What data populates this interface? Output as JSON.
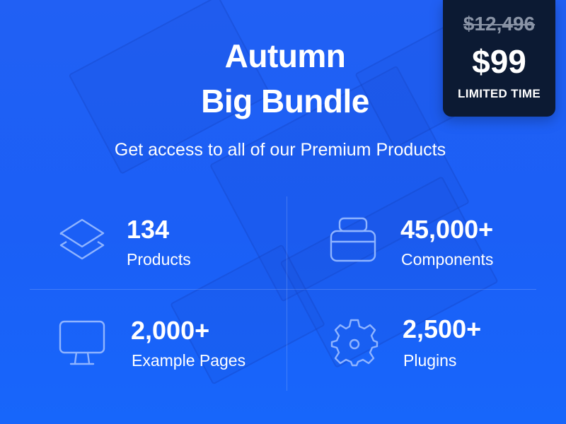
{
  "hero": {
    "title_line1": "Autumn",
    "title_line2": "Big Bundle",
    "subtitle": "Get access to all of our Premium Products"
  },
  "price_card": {
    "old_price": "$12,496",
    "new_price": "$99",
    "badge": "LIMITED TIME"
  },
  "stats": [
    {
      "value": "134",
      "label": "Products",
      "icon": "layers-icon"
    },
    {
      "value": "45,000+",
      "label": "Components",
      "icon": "components-icon"
    },
    {
      "value": "2,000+",
      "label": "Example Pages",
      "icon": "monitor-icon"
    },
    {
      "value": "2,500+",
      "label": "Plugins",
      "icon": "gear-icon"
    }
  ],
  "colors": {
    "background": "#1f63f5",
    "price_card": "#0c1a33",
    "icon_stroke": "#8fb4ff",
    "muted_price": "#8a94a6"
  }
}
